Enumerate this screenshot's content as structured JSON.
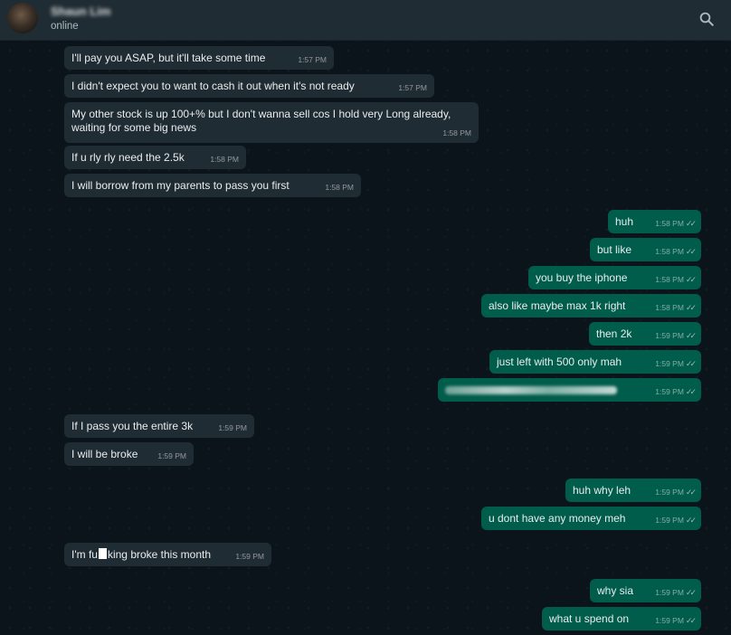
{
  "header": {
    "contact_name": "Shaun Lim",
    "status": "online"
  },
  "messages": [
    {
      "dir": "in",
      "text": "I'll pay you ASAP, but it'll take some time",
      "time": "1:57 PM"
    },
    {
      "dir": "in",
      "text": "I didn't expect you to want to cash it out when it's not ready",
      "time": "1:57 PM"
    },
    {
      "dir": "in",
      "text": "My other stock is up 100+% but I don't wanna sell cos I hold very Long already, waiting for some big news",
      "time": "1:58 PM"
    },
    {
      "dir": "in",
      "text": "If u rly rly need the 2.5k",
      "time": "1:58 PM"
    },
    {
      "dir": "in",
      "text": "I will borrow from my parents to pass you first",
      "time": "1:58 PM"
    },
    {
      "dir": "out",
      "text": "huh",
      "time": "1:58 PM"
    },
    {
      "dir": "out",
      "text": "but like",
      "time": "1:58 PM"
    },
    {
      "dir": "out",
      "text": "you buy the iphone",
      "time": "1:58 PM"
    },
    {
      "dir": "out",
      "text": "also like maybe max 1k right",
      "time": "1:58 PM"
    },
    {
      "dir": "out",
      "text": "then 2k",
      "time": "1:59 PM"
    },
    {
      "dir": "out",
      "text": "just left with 500 only mah",
      "time": "1:59 PM"
    },
    {
      "dir": "out",
      "text": "",
      "time": "1:59 PM"
    },
    {
      "dir": "in",
      "text": "If I pass you the entire 3k",
      "time": "1:59 PM"
    },
    {
      "dir": "in",
      "text": "I will be broke",
      "time": "1:59 PM"
    },
    {
      "dir": "out",
      "text": "huh why leh",
      "time": "1:59 PM"
    },
    {
      "dir": "out",
      "text": "u dont have any money meh",
      "time": "1:59 PM"
    },
    {
      "dir": "in",
      "text_before": "I'm fu",
      "text_after": "king broke this month",
      "time": "1:59 PM"
    },
    {
      "dir": "out",
      "text": "why sia",
      "time": "1:59 PM"
    },
    {
      "dir": "out",
      "text": "what u spend on",
      "time": "1:59 PM"
    }
  ],
  "icons": {
    "search": "search-icon",
    "read_receipt": "double-check-icon"
  }
}
